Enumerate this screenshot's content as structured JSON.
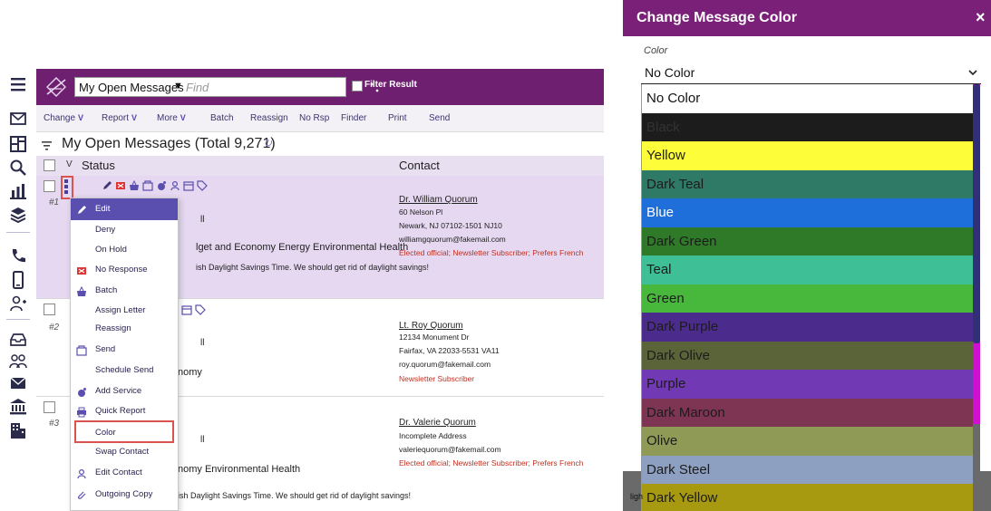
{
  "app": {
    "view_label": "My Open Messages",
    "find_placeholder": "Find",
    "filter_label": "Filter Result",
    "toolbar": {
      "change": "Change",
      "report": "Report",
      "more": "More",
      "batch": "Batch",
      "reassign": "Reassign",
      "no_rsp": "No Rsp",
      "finder": "Finder",
      "print": "Print",
      "send": "Send"
    },
    "list_title": "My Open Messages (Total 9,271)",
    "columns": {
      "status": "Status",
      "contact": "Contact"
    },
    "sidebar_icons": [
      "menu-icon",
      "mail-icon",
      "dashboard-icon",
      "search-icon",
      "chart-icon",
      "layers-icon",
      "phone-icon",
      "mobile-icon",
      "add-person-icon",
      "inbox-icon",
      "group-icon",
      "envelope-icon",
      "bank-icon",
      "building-icon"
    ]
  },
  "rows": [
    {
      "num": "#1",
      "status_fragment": "ll",
      "subject_fragment": "lget and Economy Energy Environmental Health",
      "body_fragment": "ish Daylight Savings Time. We should get rid of daylight savings!",
      "contact": {
        "name": "Dr. William Quorum",
        "address1": "60 Nelson Pl",
        "address2": "Newark, NJ 07102-1501  NJ10",
        "email": "williamgquorum@fakemail.com",
        "tags": "Elected official; Newsletter Subscriber; Prefers French"
      }
    },
    {
      "num": "#2",
      "status_fragment": "ll",
      "subject_fragment": "nomy",
      "contact": {
        "name": "Lt. Roy Quorum",
        "address1": "12134 Monument Dr",
        "address2": "Fairfax, VA 22033-5531  VA11",
        "email": "roy.quorum@fakemail.com",
        "tags": "Newsletter Subscriber"
      }
    },
    {
      "num": "#3",
      "status_fragment": "ll",
      "subject_fragment": "nomy Environmental Health",
      "body_fragment": "ish Daylight Savings Time. We should get rid of daylight savings!",
      "contact": {
        "name": "Dr. Valerie Quorum",
        "address1": "Incomplete Address",
        "email": "valeriequorum@fakemail.com",
        "tags": "Elected official; Newsletter Subscriber; Prefers French"
      }
    }
  ],
  "context_menu": {
    "items": [
      {
        "label": "Edit",
        "icon": "pencil-icon"
      },
      {
        "label": "Deny",
        "icon": ""
      },
      {
        "label": "On Hold",
        "icon": ""
      },
      {
        "label": "No Response",
        "icon": "no-response-icon"
      },
      {
        "label": "Batch",
        "icon": "basket-icon"
      },
      {
        "label": "Assign Letter",
        "icon": ""
      },
      {
        "label": "Reassign",
        "icon": ""
      },
      {
        "label": "Send",
        "icon": "send-icon"
      },
      {
        "label": "Schedule Send",
        "icon": ""
      },
      {
        "label": "Add Service",
        "icon": "service-icon"
      },
      {
        "label": "Quick Report",
        "icon": "printer-icon"
      },
      {
        "label": "Color",
        "icon": ""
      },
      {
        "label": "Swap Contact",
        "icon": ""
      },
      {
        "label": "Edit Contact",
        "icon": "person-icon"
      },
      {
        "label": "Outgoing Copy",
        "icon": "paperclip-icon"
      }
    ],
    "highlighted": "Color"
  },
  "color_dialog": {
    "title": "Change Message Color",
    "close_glyph": "×",
    "field_label": "Color",
    "selected_value": "No Color",
    "under_text": "ligh",
    "options": [
      {
        "label": "No Color",
        "color": "#ffffff",
        "text_color": "#111111"
      },
      {
        "label": "Black",
        "color": "#1c1c1c",
        "text_color": "#333333"
      },
      {
        "label": "Yellow",
        "color": "#fdfd3a",
        "text_color": "#222222"
      },
      {
        "label": "Dark Teal",
        "color": "#2f7a66",
        "text_color": "#1c1c1c"
      },
      {
        "label": "Blue",
        "color": "#1e6fd9",
        "text_color": "#ffffff"
      },
      {
        "label": "Dark Green",
        "color": "#2e7a28",
        "text_color": "#1c1c1c"
      },
      {
        "label": "Teal",
        "color": "#3ebf95",
        "text_color": "#1c1c1c"
      },
      {
        "label": "Green",
        "color": "#47b83c",
        "text_color": "#1c1c1c"
      },
      {
        "label": "Dark Purple",
        "color": "#4b2c8c",
        "text_color": "#1c1c1c"
      },
      {
        "label": "Dark Olive",
        "color": "#5a6438",
        "text_color": "#1c1c1c"
      },
      {
        "label": "Purple",
        "color": "#7239b5",
        "text_color": "#1c1c1c"
      },
      {
        "label": "Dark Maroon",
        "color": "#7d3553",
        "text_color": "#1c1c1c"
      },
      {
        "label": "Olive",
        "color": "#8f9a56",
        "text_color": "#1c1c1c"
      },
      {
        "label": "Dark Steel",
        "color": "#8ea0c2",
        "text_color": "#1c1c1c"
      },
      {
        "label": "Dark Yellow",
        "color": "#a89a10",
        "text_color": "#1c1c1c"
      }
    ]
  }
}
